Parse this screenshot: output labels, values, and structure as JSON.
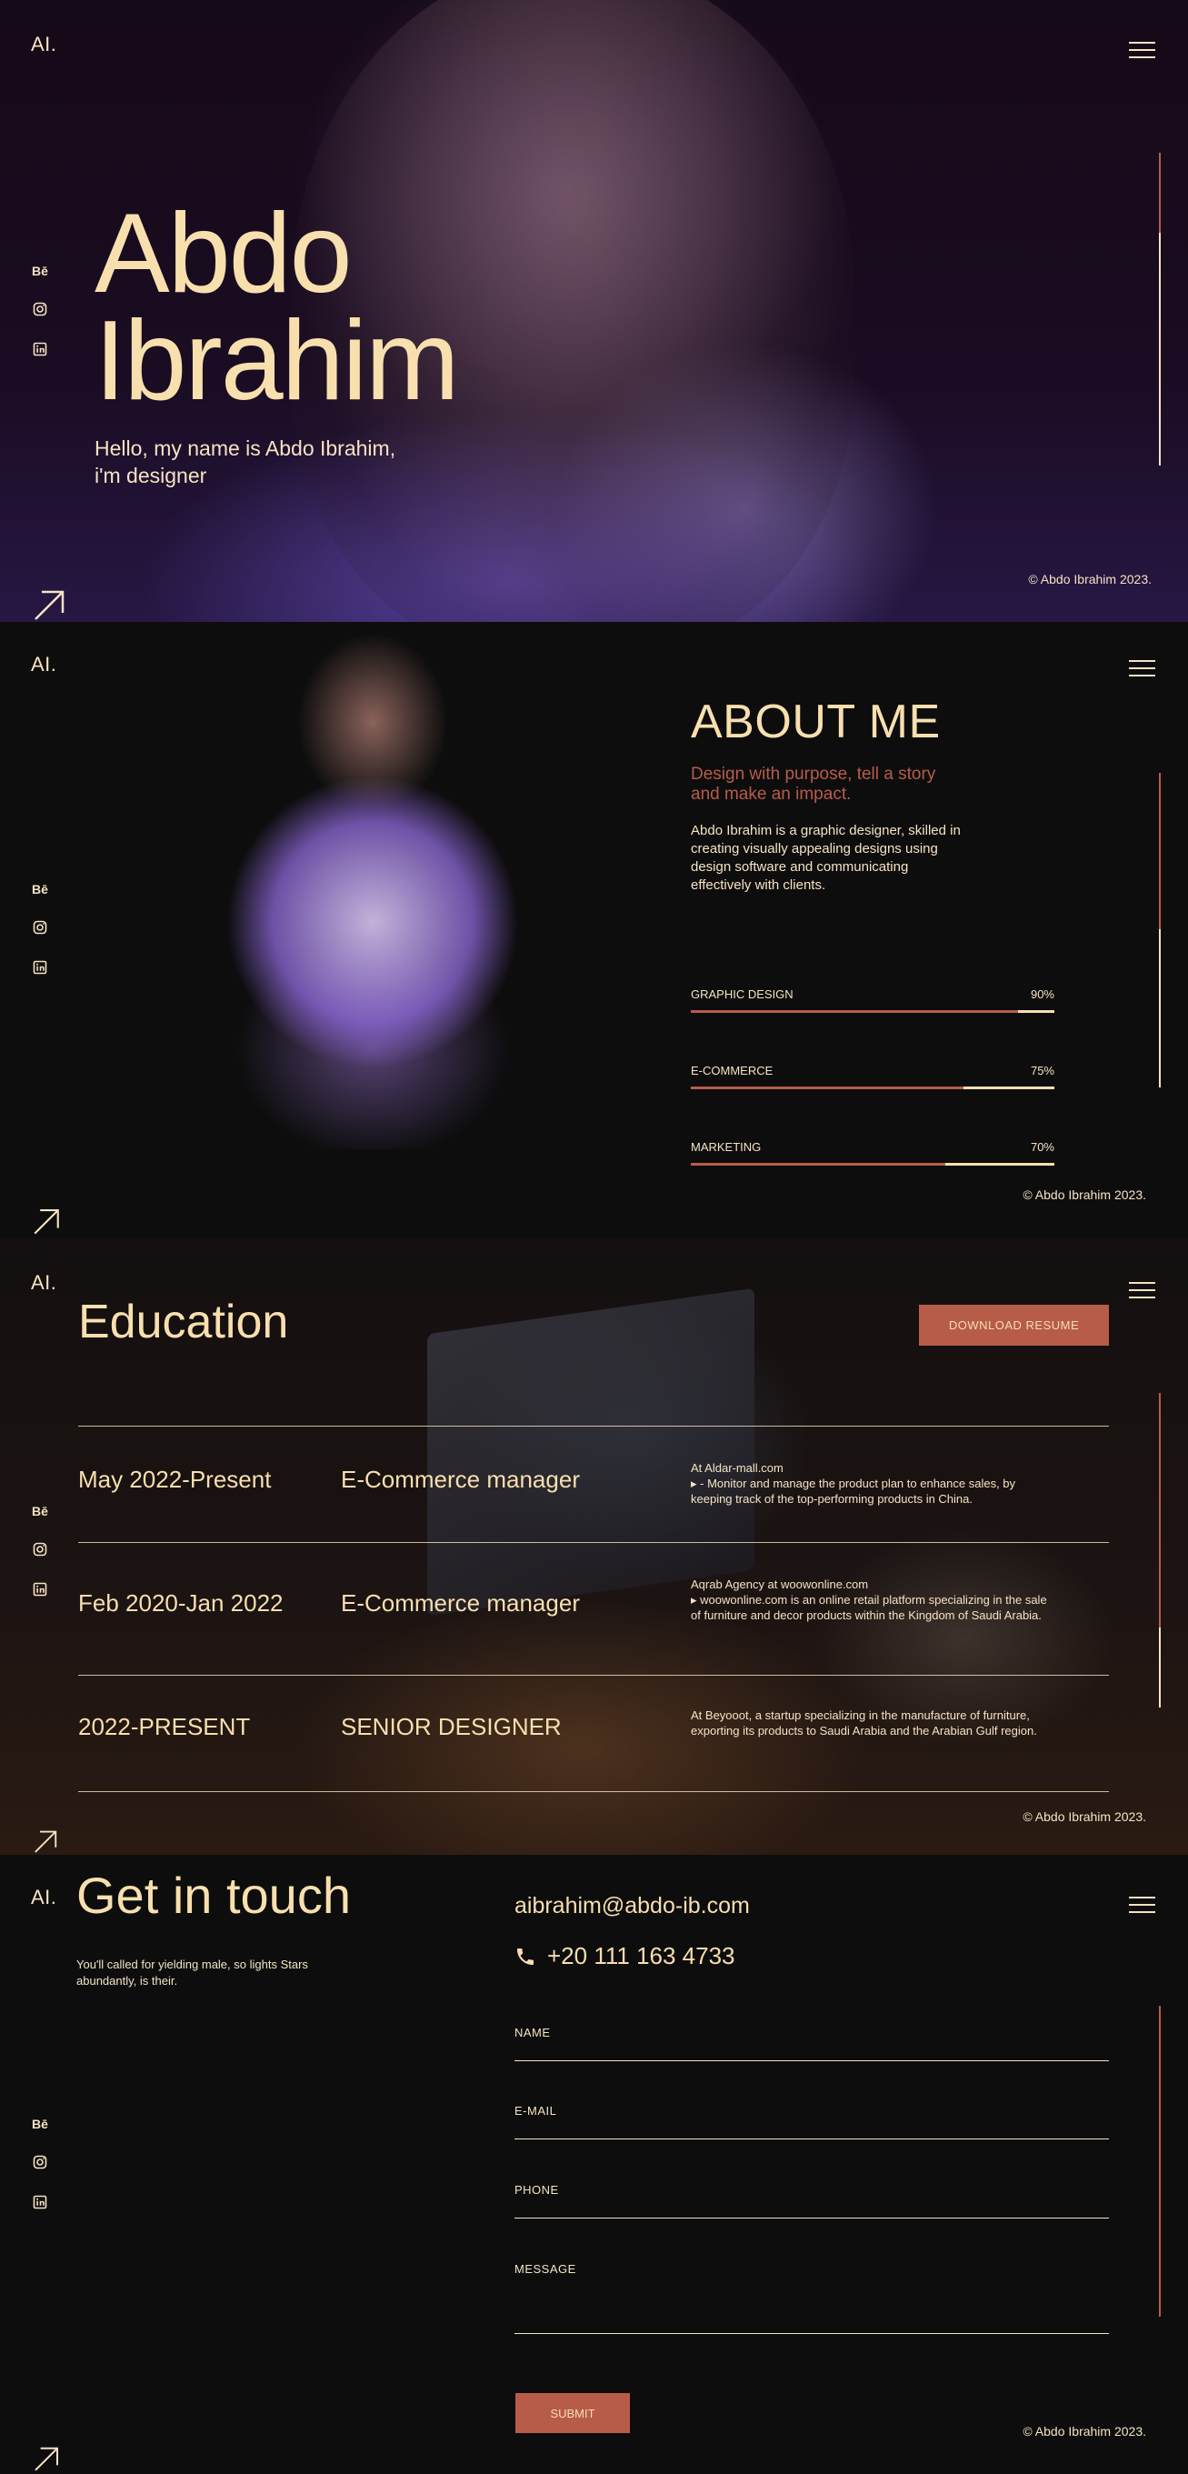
{
  "colors": {
    "accent": "#b85c4a",
    "text": "#f8dfae",
    "background": "#0d0d0d"
  },
  "brand": {
    "logo": "AI."
  },
  "socials": [
    {
      "label": "Bē",
      "icon": "behance-icon"
    },
    {
      "icon": "instagram-icon"
    },
    {
      "icon": "linkedin-icon"
    }
  ],
  "copyright": "© Abdo Ibrahim 2023.",
  "hero": {
    "name_line1": "Abdo",
    "name_line2": "Ibrahim",
    "subtitle_line1": "Hello, my name is Abdo Ibrahim,",
    "subtitle_line2": "i'm designer"
  },
  "about": {
    "title": "ABOUT ME",
    "tagline": "Design with purpose, tell a story and make an impact.",
    "bio": "Abdo Ibrahim is a graphic designer, skilled in creating visually appealing designs using design software and communicating effectively with clients.",
    "skills": [
      {
        "name": "GRAPHIC DESIGN",
        "percent": "90%",
        "level": 0.9
      },
      {
        "name": "E-COMMERCE",
        "percent": "75%",
        "level": 0.75
      },
      {
        "name": "MARKETING",
        "percent": "70%",
        "level": 0.7
      }
    ]
  },
  "education": {
    "title": "Education",
    "download_label": "DOWNLOAD RESUME",
    "entries": [
      {
        "date": "May 2022-Present",
        "role": "E-Commerce manager",
        "company": "At Aldar-mall.com",
        "detail": "▸ - Monitor and manage the product plan to enhance sales, by keeping track of the top-performing products in China."
      },
      {
        "date": "Feb 2020-Jan 2022",
        "role": "E-Commerce manager",
        "company": "Aqrab Agency at woowonline.com",
        "detail": "▸ woowonline.com is an online retail platform specializing in the sale of furniture and decor products within the Kingdom of Saudi Arabia."
      },
      {
        "date": "2022-PRESENT",
        "role": "SENIOR DESIGNER",
        "company": "",
        "detail": "At Beyooot, a startup specializing in the manufacture of furniture, exporting its products to Saudi Arabia and the Arabian Gulf region."
      }
    ]
  },
  "contact": {
    "title": "Get in touch",
    "note": "You'll called for yielding male, so lights Stars abundantly, is their.",
    "email": "aibrahim@abdo-ib.com",
    "phone": "+20 111 163 4733",
    "fields": [
      {
        "label": "NAME"
      },
      {
        "label": "E-MAIL"
      },
      {
        "label": "PHONE"
      },
      {
        "label": "MESSAGE"
      }
    ],
    "submit_label": "SUBMIT"
  }
}
